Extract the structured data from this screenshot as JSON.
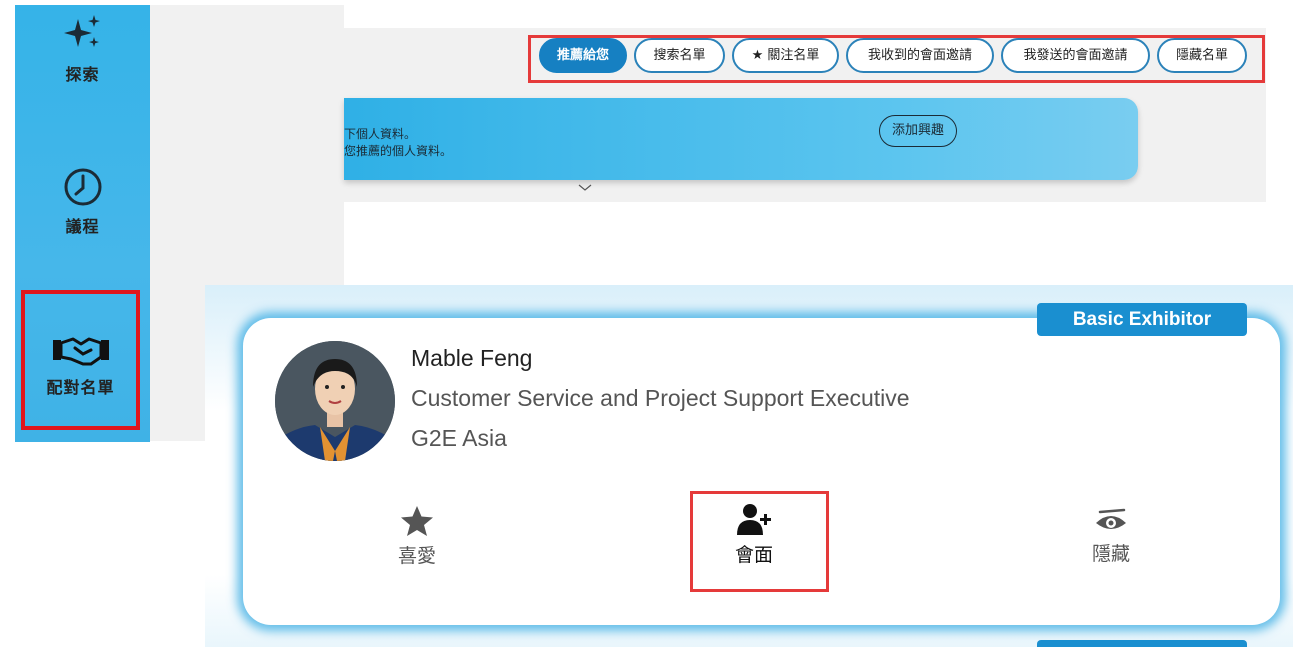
{
  "sidebar": {
    "items": [
      {
        "label": "探索",
        "icon": "sparkles-icon"
      },
      {
        "label": "議程",
        "icon": "clock-icon"
      },
      {
        "label": "配對名單",
        "icon": "handshake-icon"
      }
    ]
  },
  "tabs": [
    {
      "label": "推薦給您",
      "active": true
    },
    {
      "label": "搜索名單"
    },
    {
      "label": "★ 關注名單"
    },
    {
      "label": "我收到的會面邀請"
    },
    {
      "label": "我發送的會面邀請"
    },
    {
      "label": "隱藏名單"
    }
  ],
  "banner": {
    "line1": "下個人資料。",
    "line2": "您推薦的個人資料。",
    "button_label": "添加興趣"
  },
  "card": {
    "tier": "Basic Exhibitor",
    "name": "Mable Feng",
    "title": "Customer Service and Project Support Executive",
    "company": "G2E Asia",
    "actions": [
      {
        "label": "喜愛",
        "icon": "star-icon"
      },
      {
        "label": "會面",
        "icon": "add-user-icon"
      },
      {
        "label": "隱藏",
        "icon": "eye-icon"
      }
    ]
  },
  "colors": {
    "sidebar": "#35b3e8",
    "active_tab": "#1680c2",
    "highlight": "#e53a3a",
    "badge": "#1a8fd0"
  }
}
